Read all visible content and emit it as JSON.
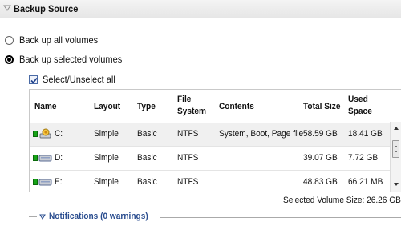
{
  "section": {
    "title": "Backup Source"
  },
  "options": {
    "all_volumes": {
      "label": "Back up all volumes",
      "selected": false
    },
    "selected_volumes": {
      "label": "Back up selected volumes",
      "selected": true
    }
  },
  "select_all": {
    "label": "Select/Unselect all",
    "checked": true
  },
  "table": {
    "headers": {
      "name": "Name",
      "layout": "Layout",
      "type": "Type",
      "fs_line1": "File",
      "fs_line2": "System",
      "contents": "Contents",
      "total": "Total Size",
      "used_line1": "Used",
      "used_line2": "Space"
    },
    "rows": [
      {
        "name": "C:",
        "icon": "system-drive-icon",
        "layout": "Simple",
        "type": "Basic",
        "fs": "NTFS",
        "contents": "System, Boot, Page file",
        "total": "58.59 GB",
        "used": "18.41 GB"
      },
      {
        "name": "D:",
        "icon": "drive-icon",
        "layout": "Simple",
        "type": "Basic",
        "fs": "NTFS",
        "contents": "",
        "total": "39.07 GB",
        "used": "7.72 GB"
      },
      {
        "name": "E:",
        "icon": "drive-icon",
        "layout": "Simple",
        "type": "Basic",
        "fs": "NTFS",
        "contents": "",
        "total": "48.83 GB",
        "used": "66.21 MB"
      }
    ]
  },
  "selected_size": "Selected Volume Size: 26.26 GB",
  "notifications": {
    "label": "Notifications (0 warnings)"
  },
  "colors": {
    "status_green": "#16a316",
    "link_blue": "#2a4d8f",
    "header_bg": "#e6e6e6"
  }
}
